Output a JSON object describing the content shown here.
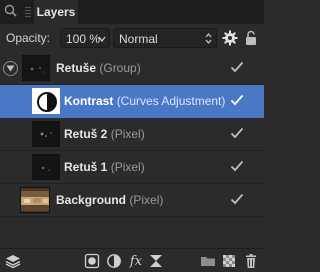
{
  "panel": {
    "tab_label": "Layers"
  },
  "options": {
    "opacity_label": "Opacity:",
    "opacity_value": "100 %",
    "blend_mode": "Normal"
  },
  "layers": [
    {
      "name": "Retuše",
      "type": "(Group)",
      "visible": true,
      "selected": false,
      "expandable": true
    },
    {
      "name": "Kontrast",
      "type": "(Curves Adjustment)",
      "visible": true,
      "selected": true
    },
    {
      "name": "Retuš 2",
      "type": "(Pixel)",
      "visible": true,
      "selected": false
    },
    {
      "name": "Retuš 1",
      "type": "(Pixel)",
      "visible": true,
      "selected": false
    },
    {
      "name": "Background",
      "type": "(Pixel)",
      "visible": true,
      "selected": false
    }
  ],
  "colors": {
    "selection": "#4a78c7",
    "panel_bg": "#2b2b2c"
  },
  "bottom_tools": [
    "layers-stack-icon",
    "mask-icon",
    "adjustment-icon",
    "fx-icon",
    "live-filter-icon",
    "folder-icon",
    "new-layer-icon",
    "trash-icon"
  ],
  "labels": {
    "fx": "fx"
  }
}
